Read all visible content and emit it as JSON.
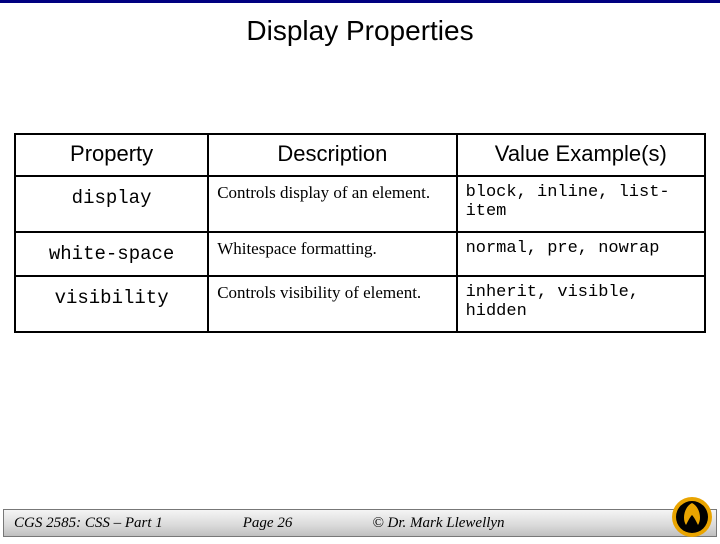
{
  "header": {
    "title": "Display Properties"
  },
  "table": {
    "columns": {
      "property": "Property",
      "description": "Description",
      "values": "Value Example(s)"
    },
    "rows": [
      {
        "property": "display",
        "description": "Controls display of an element.",
        "values": "block, inline, list-item"
      },
      {
        "property": "white-space",
        "description": "Whitespace formatting.",
        "values": "normal, pre, nowrap"
      },
      {
        "property": "visibility",
        "description": "Controls visibility of element.",
        "values": "inherit, visible, hidden"
      }
    ]
  },
  "footer": {
    "course": "CGS 2585: CSS – Part 1",
    "page": "Page 26",
    "author": "© Dr. Mark Llewellyn"
  },
  "badge": {
    "name": "ucf-pegasus-logo"
  }
}
